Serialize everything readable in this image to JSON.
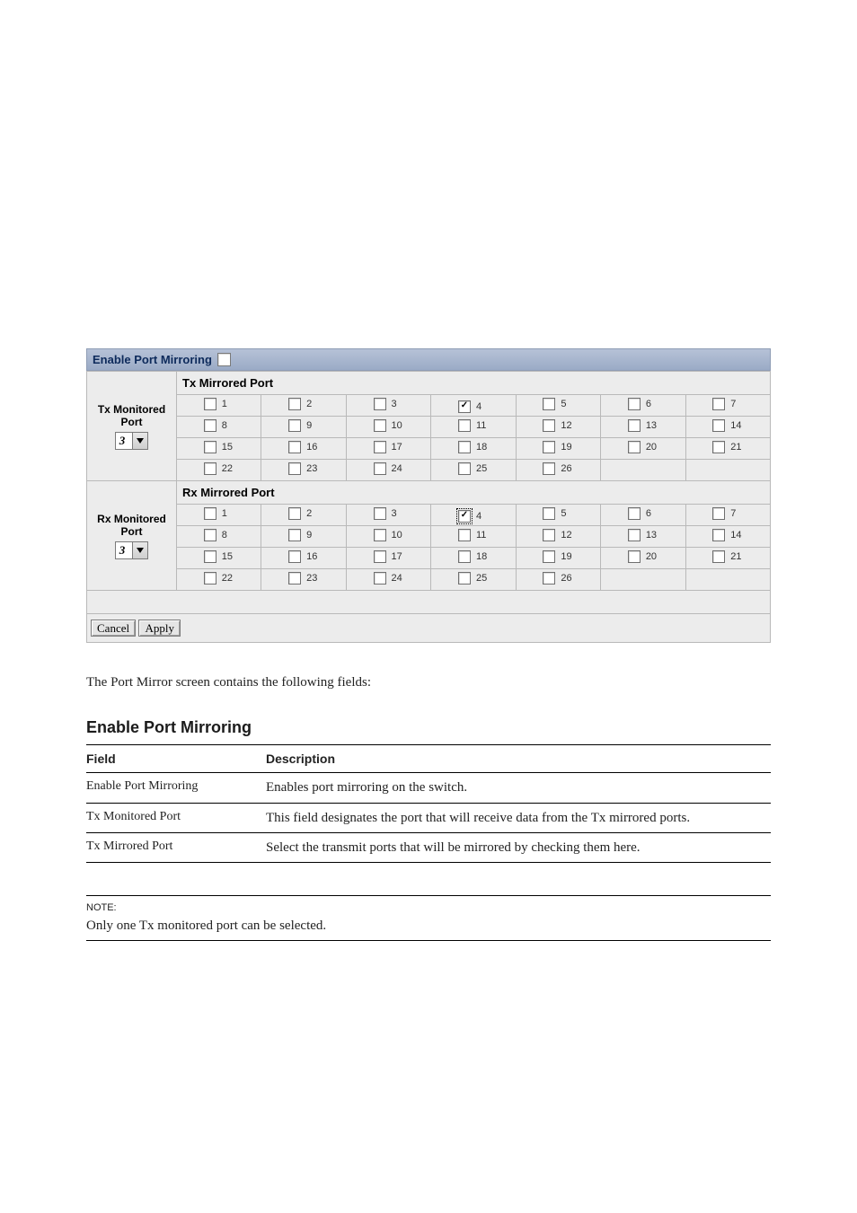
{
  "header": {
    "enable_label": "Enable Port Mirroring",
    "enable_checked": false
  },
  "tx": {
    "section_title": "Tx Mirrored Port",
    "left_label_line1": "Tx Monitored",
    "left_label_line2": "Port",
    "select_value": "3",
    "ports": [
      {
        "n": "1",
        "c": false
      },
      {
        "n": "2",
        "c": false
      },
      {
        "n": "3",
        "c": false
      },
      {
        "n": "4",
        "c": true
      },
      {
        "n": "5",
        "c": false
      },
      {
        "n": "6",
        "c": false
      },
      {
        "n": "7",
        "c": false
      },
      {
        "n": "8",
        "c": false
      },
      {
        "n": "9",
        "c": false
      },
      {
        "n": "10",
        "c": false
      },
      {
        "n": "11",
        "c": false
      },
      {
        "n": "12",
        "c": false
      },
      {
        "n": "13",
        "c": false
      },
      {
        "n": "14",
        "c": false
      },
      {
        "n": "15",
        "c": false
      },
      {
        "n": "16",
        "c": false
      },
      {
        "n": "17",
        "c": false
      },
      {
        "n": "18",
        "c": false
      },
      {
        "n": "19",
        "c": false
      },
      {
        "n": "20",
        "c": false
      },
      {
        "n": "21",
        "c": false
      },
      {
        "n": "22",
        "c": false
      },
      {
        "n": "23",
        "c": false
      },
      {
        "n": "24",
        "c": false
      },
      {
        "n": "25",
        "c": false
      },
      {
        "n": "26",
        "c": false
      }
    ]
  },
  "rx": {
    "section_title": "Rx Mirrored Port",
    "left_label_line1": "Rx Monitored",
    "left_label_line2": "Port",
    "select_value": "3",
    "ports": [
      {
        "n": "1",
        "c": false
      },
      {
        "n": "2",
        "c": false
      },
      {
        "n": "3",
        "c": false
      },
      {
        "n": "4",
        "c": true,
        "focus": true
      },
      {
        "n": "5",
        "c": false
      },
      {
        "n": "6",
        "c": false
      },
      {
        "n": "7",
        "c": false
      },
      {
        "n": "8",
        "c": false
      },
      {
        "n": "9",
        "c": false
      },
      {
        "n": "10",
        "c": false
      },
      {
        "n": "11",
        "c": false
      },
      {
        "n": "12",
        "c": false
      },
      {
        "n": "13",
        "c": false
      },
      {
        "n": "14",
        "c": false
      },
      {
        "n": "15",
        "c": false
      },
      {
        "n": "16",
        "c": false
      },
      {
        "n": "17",
        "c": false
      },
      {
        "n": "18",
        "c": false
      },
      {
        "n": "19",
        "c": false
      },
      {
        "n": "20",
        "c": false
      },
      {
        "n": "21",
        "c": false
      },
      {
        "n": "22",
        "c": false
      },
      {
        "n": "23",
        "c": false
      },
      {
        "n": "24",
        "c": false
      },
      {
        "n": "25",
        "c": false
      },
      {
        "n": "26",
        "c": false
      }
    ]
  },
  "buttons": {
    "cancel": "Cancel",
    "apply": "Apply"
  },
  "caption": "The Port Mirror screen contains the following fields:",
  "section_title_text": "Enable Port Mirroring",
  "fields": {
    "heading_field": "Field",
    "heading_desc": "Description",
    "row1_field": "Enable Port Mirroring",
    "row1_desc": "Enables port mirroring on the switch.",
    "row2_field": "Tx Monitored Port",
    "row2_desc": "This field designates the port that will receive data from the Tx mirrored ports.",
    "row3_field": "Tx Mirrored Port",
    "row3_desc": "Select the transmit ports that will be mirrored by checking them here."
  },
  "note": {
    "label": "NOTE:",
    "text": "Only one Tx monitored port can be selected."
  }
}
